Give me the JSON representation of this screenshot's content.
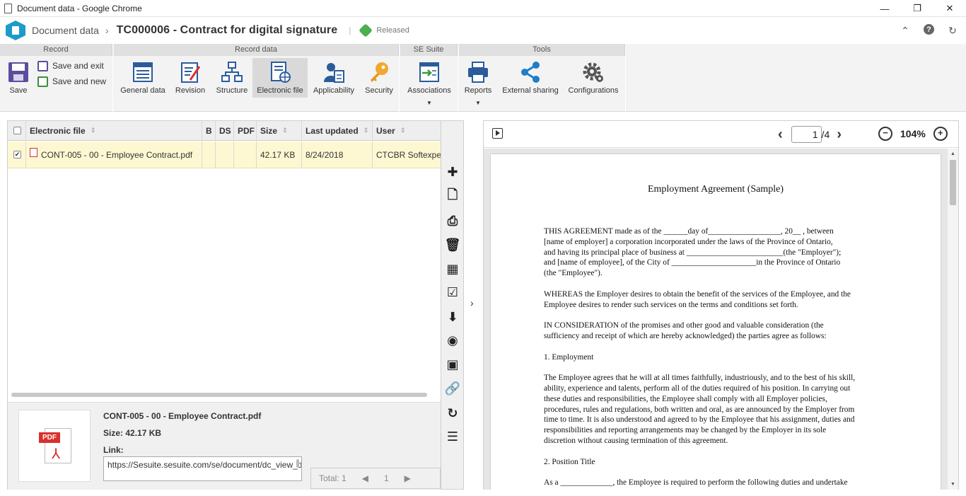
{
  "window": {
    "title": "Document data - Google Chrome"
  },
  "header": {
    "crumb": "Document data",
    "record_title": "TC000006 - Contract for digital signature",
    "separator": "|",
    "status": "Released"
  },
  "ribbon": {
    "groups": [
      "Record",
      "Record data",
      "SE Suite",
      "Tools"
    ],
    "save": "Save",
    "save_and_exit": "Save and exit",
    "save_and_new": "Save and new",
    "general_data": "General data",
    "revision": "Revision",
    "structure": "Structure",
    "electronic_file": "Electronic file",
    "applicability": "Applicability",
    "security": "Security",
    "associations": "Associations",
    "reports": "Reports",
    "external_sharing": "External sharing",
    "configurations": "Configurations"
  },
  "grid": {
    "columns": [
      "Electronic file",
      "B",
      "DS",
      "PDF",
      "Size",
      "Last updated",
      "User"
    ],
    "rows": [
      {
        "file": "CONT-005 - 00 - Employee Contract.pdf",
        "b": "",
        "ds": "",
        "pdf": "",
        "size": "42.17 KB",
        "updated": "8/24/2018",
        "user": "CTCBR Softexpert"
      }
    ]
  },
  "detail": {
    "name": "CONT-005 - 00 - Employee Contract.pdf",
    "size": "Size: 42.17 KB",
    "link_label": "Link:",
    "link": "https://Sesuite.sesuite.com/se/document/dc_view_document/api_view_document.php?",
    "pdf_tag": "PDF"
  },
  "pager": {
    "total": "Total: 1",
    "page": "1",
    "prev": "◀",
    "next": "▶"
  },
  "viewer": {
    "page": "1",
    "total_pages": "/4",
    "zoom": "104%",
    "doc_title": "Employment Agreement (Sample)",
    "paragraphs": [
      "THIS AGREEMENT made as of the ______day of__________________, 20__ , between\n[name of employer] a corporation incorporated under the laws of the Province of Ontario,\nand having its principal place of business at ________________________(the \"Employer\");\nand [name of employee], of the City of _____________________in the Province of Ontario\n(the \"Employee\").",
      "WHEREAS the Employer desires to obtain the benefit of the services of the Employee, and the\nEmployee desires to render such services on the terms and conditions set forth.",
      "IN CONSIDERATION of the promises and other good and valuable consideration (the\nsufficiency and receipt of which are hereby acknowledged) the parties agree as follows:",
      "1. Employment",
      "The Employee agrees that he will at all times faithfully, industriously, and to the best of his skill,\nability, experience and talents, perform all of the duties required of his position. In carrying out\nthese duties and responsibilities, the Employee shall comply with all Employer policies,\nprocedures, rules and regulations, both written and oral, as are announced by the Employer from\ntime to time. It is also understood and agreed to by the Employee that his assignment, duties and\nresponsibilities and reporting arrangements may be changed by the Employer in its sole\ndiscretion without causing termination of this agreement.",
      "2. Position Title",
      "As a _____________, the Employee is required to perform the following duties and undertake"
    ]
  },
  "colors": {
    "accent": "#1e9bc8",
    "status_green": "#4caf50",
    "row_selected": "#fdf8d2",
    "pdf_red": "#d9302c"
  }
}
